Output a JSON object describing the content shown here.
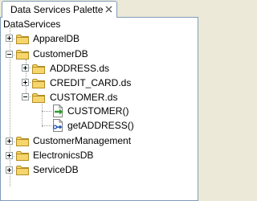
{
  "palette": {
    "title": "Data Services Palette"
  },
  "tree": {
    "root": "DataServices",
    "items": {
      "appareldb": "ApparelDB",
      "customerdb": "CustomerDB",
      "address_ds": "ADDRESS.ds",
      "credit_card_ds": "CREDIT_CARD.ds",
      "customer_ds": "CUSTOMER.ds",
      "customer_fn": "CUSTOMER()",
      "getaddress_fn": "getADDRESS()",
      "customermanagement": "CustomerManagement",
      "electronicsdb": "ElectronicsDB",
      "servicedb": "ServiceDB"
    }
  },
  "icons": {
    "folder": "folder-icon",
    "read_function": "read-function-icon",
    "navigation_function": "navigation-function-icon"
  },
  "colors": {
    "border": "#7f9db9",
    "folder_fill": "#f5d56c",
    "folder_stroke": "#b38f24",
    "arrow_green": "#2e9d2e",
    "arrow_blue": "#1f4fb0"
  }
}
